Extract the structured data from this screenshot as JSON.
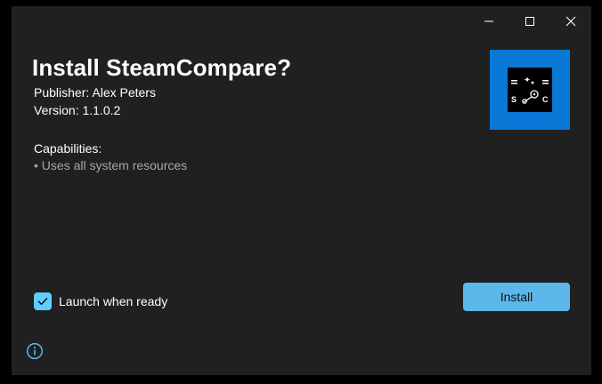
{
  "window": {
    "controls": {
      "minimize_icon": "minimize-icon",
      "maximize_icon": "maximize-icon",
      "close_icon": "close-icon"
    }
  },
  "installer": {
    "title": "Install SteamCompare?",
    "publisher": "Publisher: Alex Peters",
    "version": "Version: 1.1.0.2",
    "capabilities_heading": "Capabilities:",
    "capabilities": [
      "• Uses all system resources"
    ],
    "app_tile": {
      "icon": "steamcompare-logo-icon",
      "tile_color": "#0a78d7",
      "logo_letters": [
        "S",
        "C"
      ]
    },
    "launch_when_ready": {
      "label": "Launch when ready",
      "checked": true
    },
    "install_button": "Install",
    "info_icon": "info-icon"
  },
  "colors": {
    "window_bg": "#202020",
    "accent": "#5cb7ea",
    "checkbox_accent": "#60cdff",
    "secondary_text": "#a6a6a6",
    "info_icon": "#60cdff"
  }
}
